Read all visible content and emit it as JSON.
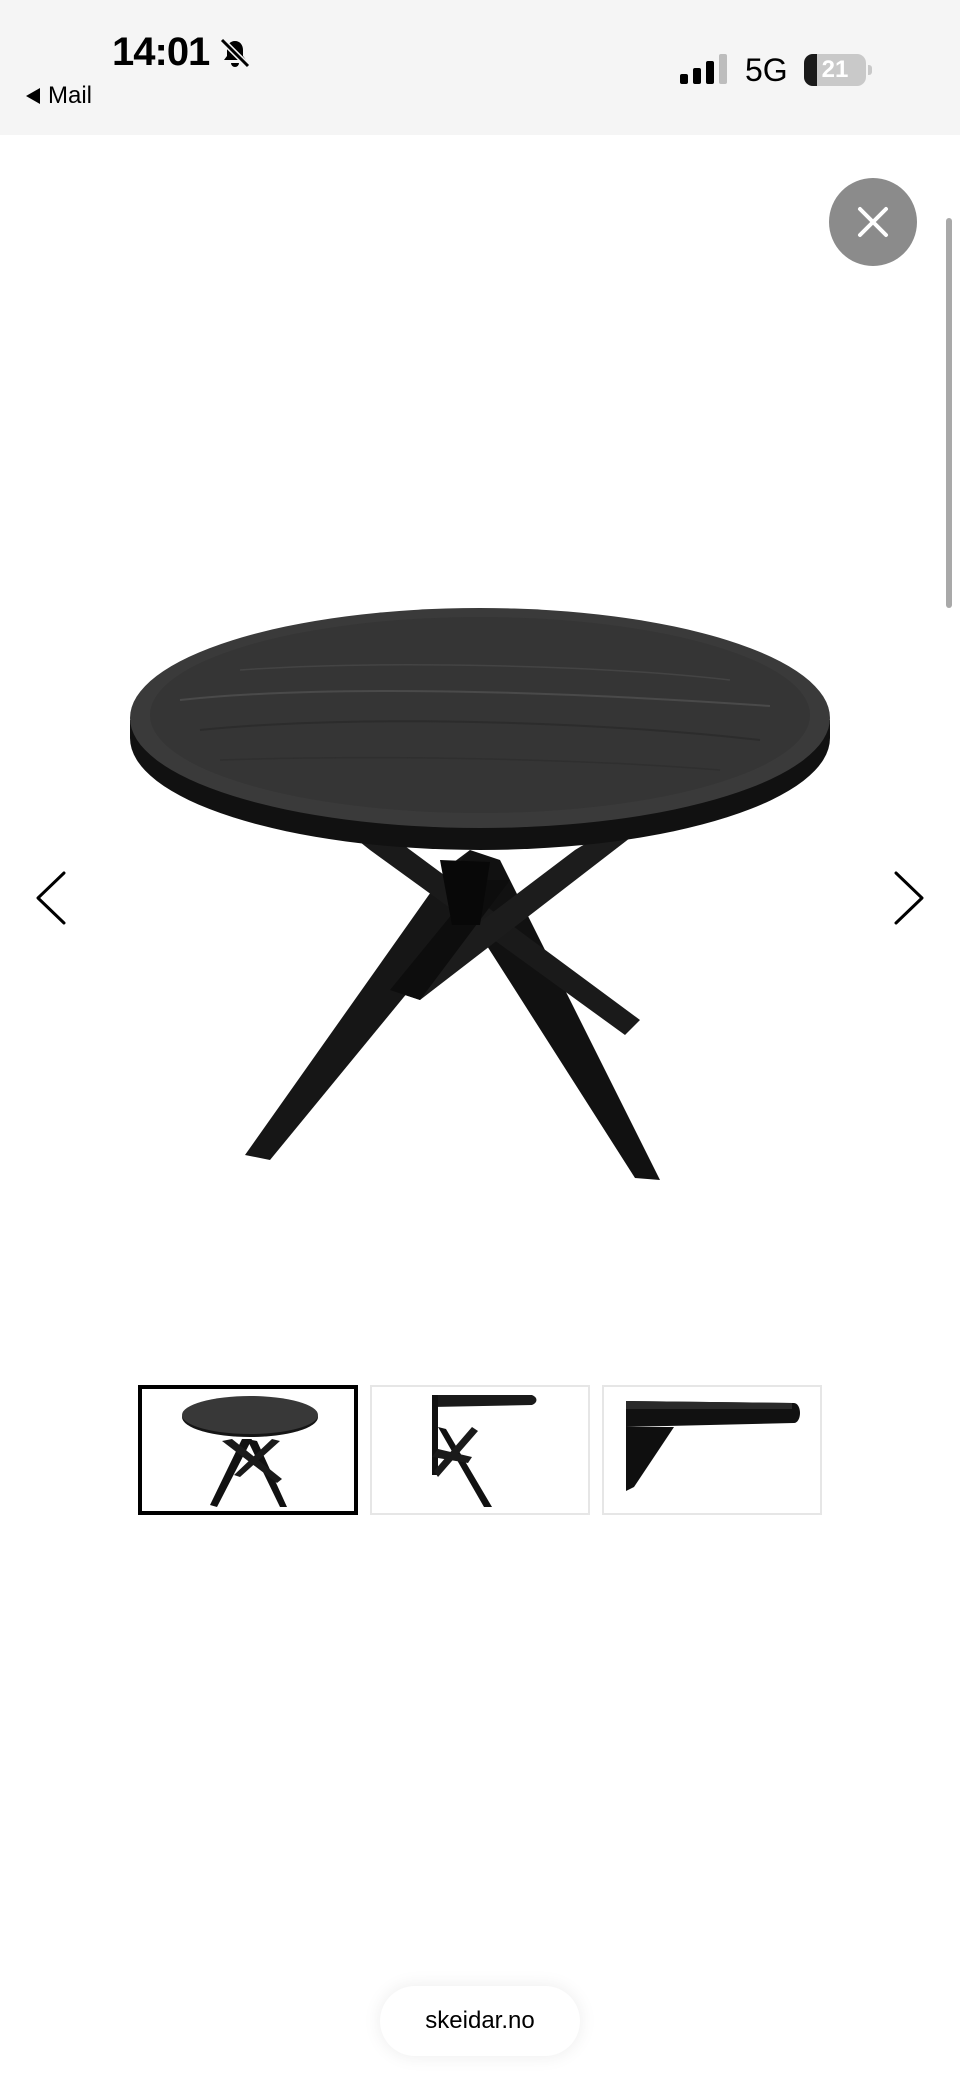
{
  "status_bar": {
    "time": "14:01",
    "back_app": "Mail",
    "network": "5G",
    "battery_level": "21",
    "battery_fraction": 0.21
  },
  "icons": {
    "mute": "bell-slash-icon",
    "signal": "cellular-signal-icon",
    "battery": "battery-icon",
    "close": "close-icon",
    "prev": "chevron-left-icon",
    "next": "chevron-right-icon"
  },
  "gallery": {
    "image_count": 3,
    "selected_index": 0
  },
  "browser": {
    "domain": "skeidar.no"
  }
}
